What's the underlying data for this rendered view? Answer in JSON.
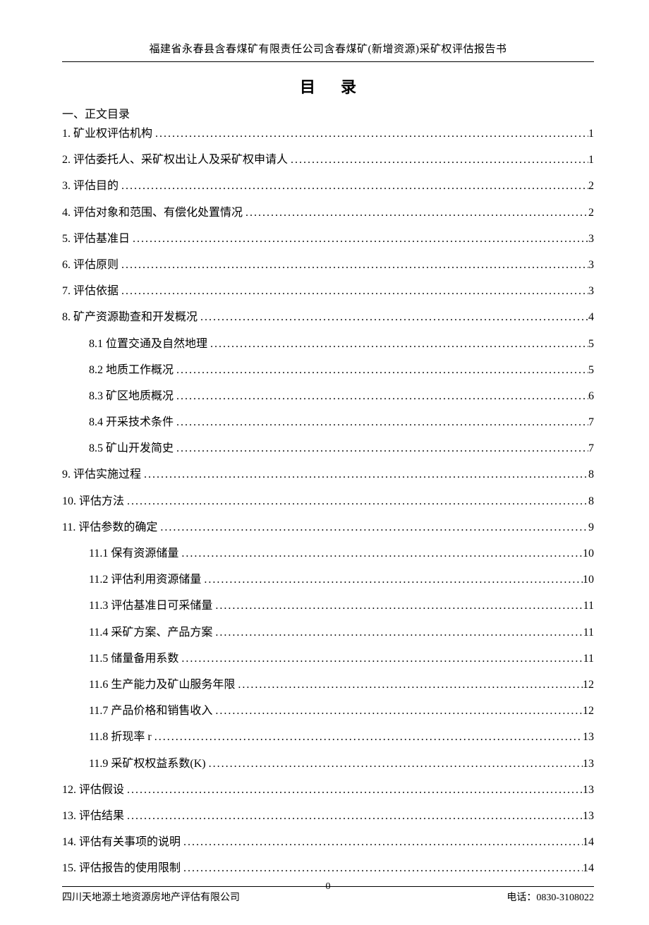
{
  "header": "福建省永春县含春煤矿有限责任公司含春煤矿(新增资源)采矿权评估报告书",
  "title": "目录",
  "section_head": "一、正文目录",
  "toc": [
    {
      "label": "1.  矿业权评估机构",
      "page": "1",
      "indent": 0
    },
    {
      "label": "2.  评估委托人、采矿权出让人及采矿权申请人",
      "page": "1",
      "indent": 0
    },
    {
      "label": "3.  评估目的",
      "page": "2",
      "indent": 0
    },
    {
      "label": "4.  评估对象和范围、有偿化处置情况",
      "page": "2",
      "indent": 0
    },
    {
      "label": "5.  评估基准日",
      "page": "3",
      "indent": 0
    },
    {
      "label": "6.  评估原则",
      "page": "3",
      "indent": 0
    },
    {
      "label": "7.  评估依据",
      "page": "3",
      "indent": 0
    },
    {
      "label": "8.  矿产资源勘查和开发概况",
      "page": "4",
      "indent": 0
    },
    {
      "label": "8.1 位置交通及自然地理",
      "page": "5",
      "indent": 1
    },
    {
      "label": "8.2 地质工作概况",
      "page": "5",
      "indent": 1
    },
    {
      "label": "8.3 矿区地质概况",
      "page": "6",
      "indent": 1
    },
    {
      "label": "8.4 开采技术条件",
      "page": "7",
      "indent": 1
    },
    {
      "label": "8.5 矿山开发简史",
      "page": "7",
      "indent": 1
    },
    {
      "label": "9.  评估实施过程",
      "page": "8",
      "indent": 0
    },
    {
      "label": "10.  评估方法",
      "page": "8",
      "indent": 0
    },
    {
      "label": "11. 评估参数的确定",
      "page": "9",
      "indent": 0
    },
    {
      "label": "11.1 保有资源储量",
      "page": "10",
      "indent": 1
    },
    {
      "label": "11.2 评估利用资源储量",
      "page": "10",
      "indent": 1
    },
    {
      "label": "11.3 评估基准日可采储量",
      "page": "11",
      "indent": 1
    },
    {
      "label": "11.4 采矿方案、产品方案",
      "page": "11",
      "indent": 1
    },
    {
      "label": "11.5 储量备用系数",
      "page": "11",
      "indent": 1
    },
    {
      "label": "11.6 生产能力及矿山服务年限",
      "page": "12",
      "indent": 1
    },
    {
      "label": "11.7 产品价格和销售收入",
      "page": "12",
      "indent": 1
    },
    {
      "label": "11.8 折现率 r",
      "page": "13",
      "indent": 1
    },
    {
      "label": "11.9 采矿权权益系数(K)",
      "page": "13",
      "indent": 1
    },
    {
      "label": "12. 评估假设",
      "page": "13",
      "indent": 0
    },
    {
      "label": "13.  评估结果",
      "page": "13",
      "indent": 0
    },
    {
      "label": "14.  评估有关事项的说明",
      "page": "14",
      "indent": 0
    },
    {
      "label": "15.  评估报告的使用限制",
      "page": "14",
      "indent": 0
    }
  ],
  "footer": {
    "company": "四川天地源土地资源房地产评估有限公司",
    "phone": "电话：0830-3108022",
    "page_num": "0"
  }
}
